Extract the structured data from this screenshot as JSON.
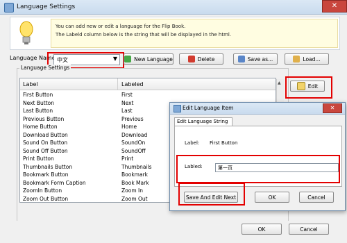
{
  "window": {
    "title": "Language Settings",
    "close_glyph": "✕"
  },
  "info": {
    "line1": "You can add new or edit  a language for the Flip Book.",
    "line2": "The Labeld column below is the string that will be displayed in the html."
  },
  "language": {
    "label": "Language Name",
    "value": "中文",
    "dropdown_glyph": "▼"
  },
  "toolbar": {
    "new_label": "New Language",
    "delete_label": "Delete",
    "save_label": "Save as...",
    "load_label": "Load...",
    "edit_label": "Edit"
  },
  "settings": {
    "group_label": "Language Settings",
    "col_label": "Label",
    "col_labeled": "Labeled",
    "rows": [
      [
        "First Button",
        "First"
      ],
      [
        "Next Button",
        "Next"
      ],
      [
        "Last Button",
        "Last"
      ],
      [
        "Previous Button",
        "Previous"
      ],
      [
        "Home Button",
        "Home"
      ],
      [
        "Download Button",
        "Download"
      ],
      [
        "Sound On Button",
        "SoundOn"
      ],
      [
        "Sound Off Button",
        "SoundOff"
      ],
      [
        "Print Button",
        "Print"
      ],
      [
        "Thumbnails Button",
        "Thumbnails"
      ],
      [
        "Bookmark Button",
        "Bookmark"
      ],
      [
        "Bookmark Form Caption",
        "Book Mark"
      ],
      [
        "ZoomIn Button",
        "Zoom In"
      ],
      [
        "Zoom Out Button",
        "Zoom Out"
      ]
    ],
    "scroll_glyph": "▲"
  },
  "dialog": {
    "title": "Edit Language Item",
    "close_glyph": "✕",
    "tab": "Edit Language String",
    "label_caption": "Label:",
    "label_value": "First Button",
    "labled_caption": "Labled:",
    "labled_value": "第一页",
    "save_next": "Save And Edit Next",
    "ok": "OK",
    "cancel": "Cancel"
  },
  "footer": {
    "ok": "OK",
    "cancel": "Cancel"
  },
  "colors": {
    "highlight": "#e30000"
  }
}
